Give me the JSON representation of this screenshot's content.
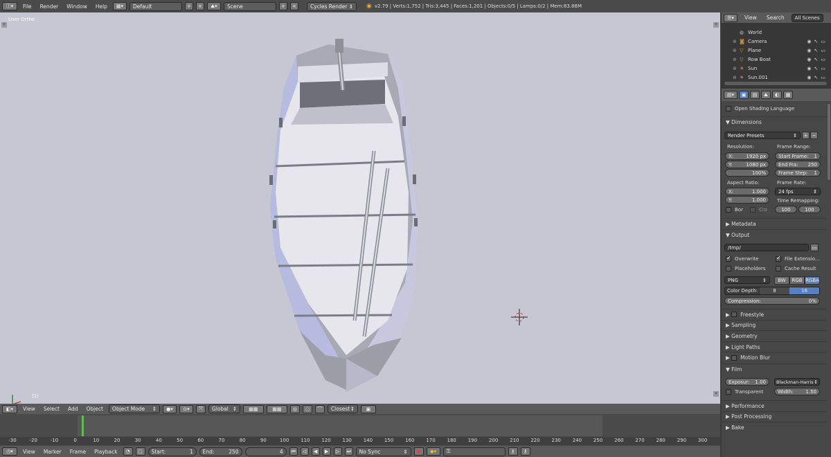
{
  "topbar": {
    "menus": [
      "File",
      "Render",
      "Window",
      "Help"
    ],
    "screen_layout": "Default",
    "scene": "Scene",
    "render_engine": "Cycles Render",
    "stats": "v2.79 | Verts:1,752 | Tris:3,445 | Faces:1,201 | Objects:0/5 | Lamps:0/2 | Mem:83.88M"
  },
  "viewport": {
    "view_name": "User Ortho",
    "frame_indicator": "(1)"
  },
  "view3d_header": {
    "menus": [
      "View",
      "Select",
      "Add",
      "Object"
    ],
    "mode": "Object Mode",
    "orientation": "Global",
    "snap_target": "Closest"
  },
  "timeline": {
    "ticks": [
      "-30",
      "-20",
      "-10",
      "0",
      "10",
      "20",
      "30",
      "40",
      "50",
      "60",
      "70",
      "80",
      "90",
      "100",
      "110",
      "120",
      "130",
      "140",
      "150",
      "160",
      "170",
      "180",
      "190",
      "200",
      "210",
      "220",
      "230",
      "240",
      "250",
      "260",
      "270",
      "280",
      "290",
      "300"
    ],
    "menus": [
      "View",
      "Marker",
      "Frame",
      "Playback"
    ],
    "start_label": "Start:",
    "start_value": "1",
    "end_label": "End:",
    "end_value": "250",
    "current_frame": "4",
    "sync": "No Sync"
  },
  "outliner": {
    "tabs": [
      "View",
      "Search",
      "All Scenes"
    ],
    "items": [
      {
        "name": "World",
        "icon": "world-icon"
      },
      {
        "name": "Camera",
        "icon": "camera-icon"
      },
      {
        "name": "Plane",
        "icon": "mesh-icon"
      },
      {
        "name": "Row Boat",
        "icon": "mesh-icon"
      },
      {
        "name": "Sun",
        "icon": "lamp-icon"
      },
      {
        "name": "Sun.001",
        "icon": "lamp-icon"
      }
    ]
  },
  "properties": {
    "osl_label": "Open Shading Language",
    "dimensions_title": "Dimensions",
    "render_presets": "Render Presets",
    "resolution_label": "Resolution:",
    "res_x_label": "X:",
    "res_x": "1920 px",
    "res_y_label": "Y:",
    "res_y": "1080 px",
    "res_pct": "100%",
    "frame_range_label": "Frame Range:",
    "start_frame_label": "Start Frame:",
    "start_frame": "1",
    "end_frame_label": "End Fra:",
    "end_frame": "250",
    "frame_step_label": "Frame Step:",
    "frame_step": "1",
    "aspect_label": "Aspect Ratio:",
    "aspect_x_label": "X:",
    "aspect_x": "1.000",
    "aspect_y_label": "Y:",
    "aspect_y": "1.000",
    "frame_rate_label": "Frame Rate:",
    "frame_rate": "24 fps",
    "time_remap_label": "Time Remapping:",
    "remap_old": "100",
    "remap_new": "100",
    "border_label": "Bor",
    "crop_label": "Cro",
    "metadata_title": "Metadata",
    "output_title": "Output",
    "output_path": "/tmp/",
    "overwrite_label": "Overwrite",
    "file_ext_label": "File Extensio...",
    "placeholders_label": "Placeholders",
    "cache_label": "Cache Result",
    "file_format": "PNG",
    "color_modes": [
      "BW",
      "RGB",
      "RGBA"
    ],
    "color_depth_label": "Color Depth:",
    "depths": [
      "8",
      "16"
    ],
    "compression_label": "Compression:",
    "compression": "0%",
    "collapsed_panels": [
      "Freestyle",
      "Sampling",
      "Geometry",
      "Light Paths",
      "Motion Blur"
    ],
    "film_title": "Film",
    "exposure_label": "Exposur:",
    "exposure": "1.00",
    "filter": "Blackman-Harris",
    "transparent_label": "Transparent",
    "width_label": "Width:",
    "width": "1.50",
    "bottom_panels": [
      "Performance",
      "Post Processing",
      "Bake"
    ]
  },
  "colors": {
    "viewport_bg": "#c6c7d2",
    "accent_selected": "#5680c2",
    "playhead": "#5fbf4f"
  }
}
